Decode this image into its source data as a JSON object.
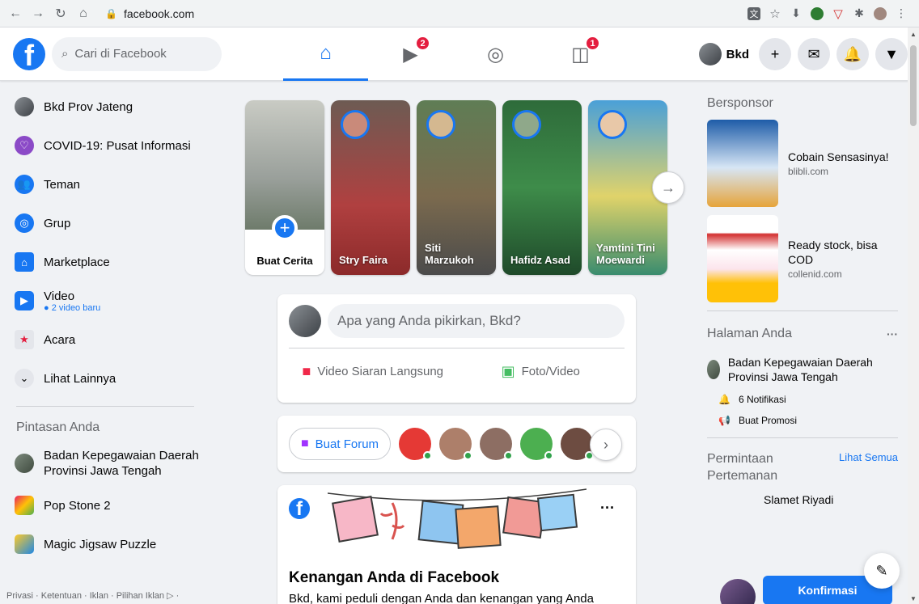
{
  "browser": {
    "url": "facebook.com",
    "icons": [
      "back-icon",
      "forward-icon",
      "reload-icon",
      "home-icon",
      "lock-icon",
      "translate-icon",
      "star-icon",
      "download-icon",
      "shield-icon",
      "extension-icon",
      "puzzle-icon",
      "profile-icon",
      "menu-icon"
    ]
  },
  "header": {
    "search_placeholder": "Cari di Facebook",
    "nav": [
      {
        "name": "home",
        "badge": ""
      },
      {
        "name": "watch",
        "badge": "2"
      },
      {
        "name": "groups",
        "badge": ""
      },
      {
        "name": "gaming",
        "badge": "1"
      }
    ],
    "profile_name": "Bkd"
  },
  "left_sidebar": {
    "items": [
      {
        "label": "Bkd Prov Jateng",
        "icon": "profile-avatar"
      },
      {
        "label": "COVID-19: Pusat Informasi",
        "icon": "covid-shield-icon"
      },
      {
        "label": "Teman",
        "icon": "friends-icon"
      },
      {
        "label": "Grup",
        "icon": "groups-icon"
      },
      {
        "label": "Marketplace",
        "icon": "shop-icon"
      },
      {
        "label": "Video",
        "icon": "video-icon",
        "sub": "2 video baru"
      },
      {
        "label": "Acara",
        "icon": "calendar-icon"
      },
      {
        "label": "Lihat Lainnya",
        "icon": "chevron-down-icon"
      }
    ],
    "shortcuts_heading": "Pintasan Anda",
    "shortcuts": [
      {
        "label": "Badan Kepegawaian Daerah Provinsi Jawa Tengah"
      },
      {
        "label": "Pop Stone 2"
      },
      {
        "label": "Magic Jigsaw Puzzle"
      }
    ],
    "footer": "Privasi · Ketentuan · Iklan · Pilihan Iklan ▷ ·"
  },
  "stories": [
    {
      "name": "Buat Cerita",
      "create": true
    },
    {
      "name": "Stry Faira"
    },
    {
      "name": "Siti Marzukoh"
    },
    {
      "name": "Hafidz Asad"
    },
    {
      "name": "Yamtini Tini Moewardi"
    }
  ],
  "composer": {
    "placeholder": "Apa yang Anda pikirkan, Bkd?",
    "live_label": "Video Siaran Langsung",
    "photo_label": "Foto/Video"
  },
  "rooms": {
    "button_label": "Buat Forum"
  },
  "memories": {
    "title": "Kenangan Anda di Facebook",
    "subtitle": "Bkd, kami peduli dengan Anda dan kenangan yang Anda"
  },
  "right_sidebar": {
    "sponsored_heading": "Bersponsor",
    "ads": [
      {
        "title": "Cobain Sensasinya!",
        "domain": "blibli.com"
      },
      {
        "title": "Ready stock, bisa COD",
        "domain": "collenid.com"
      }
    ],
    "pages_heading": "Halaman Anda",
    "page_name": "Badan Kepegawaian Daerah Provinsi Jawa Tengah",
    "notifications_label": "6 Notifikasi",
    "promo_label": "Buat Promosi",
    "requests_heading": "Permintaan Pertemanan",
    "see_all": "Lihat Semua",
    "request_name": "Slamet Riyadi",
    "confirm_label": "Konfirmasi"
  },
  "colors": {
    "accent": "#1877f2",
    "badge": "#e41e3f",
    "online": "#31a24c"
  }
}
